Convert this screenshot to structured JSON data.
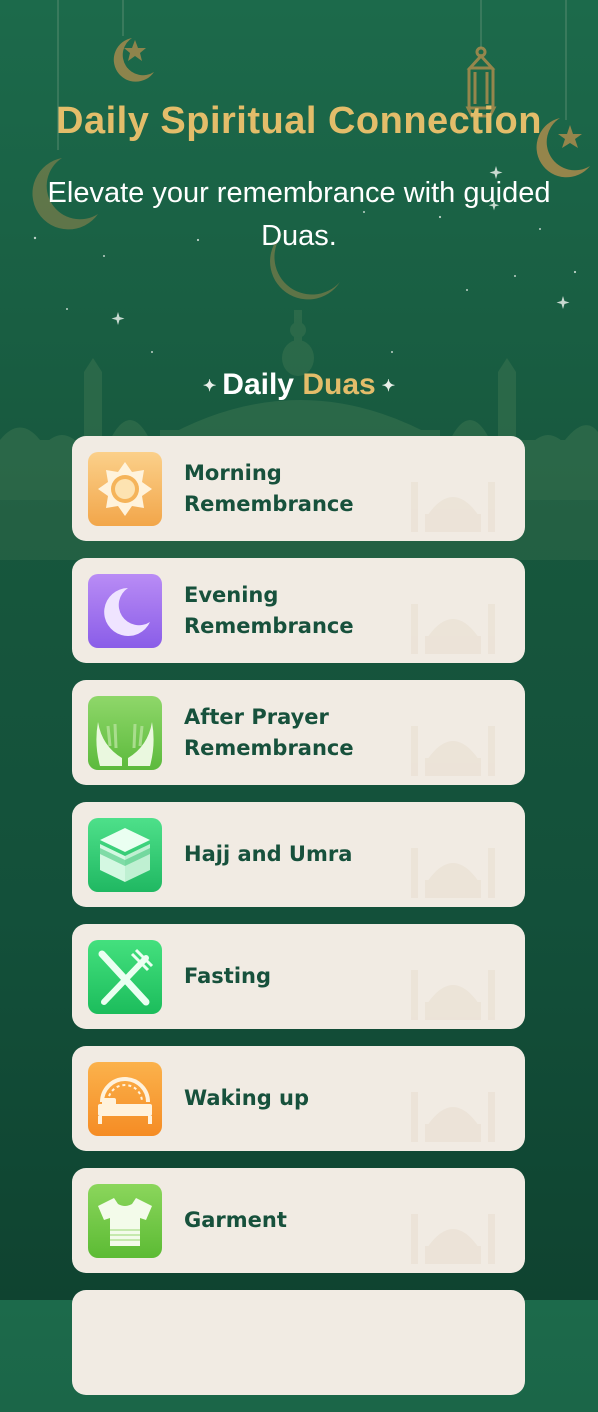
{
  "hero": {
    "title": "Daily Spiritual Connection",
    "subtitle": "Elevate your remembrance with guided Duas."
  },
  "section": {
    "title_part1": "Daily",
    "title_part2": "Duas"
  },
  "colors": {
    "background": "#17573d",
    "gold": "#e3bd6a",
    "card": "#f1ebe3",
    "label": "#17513c"
  },
  "duas": [
    {
      "label": "Morning\nRemembrance",
      "icon": "sun-icon"
    },
    {
      "label": "Evening\nRemembrance",
      "icon": "moon-icon"
    },
    {
      "label": "After Prayer\nRemembrance",
      "icon": "praying-hands-icon"
    },
    {
      "label": "Hajj and Umra",
      "icon": "kaaba-icon"
    },
    {
      "label": "Fasting",
      "icon": "fork-knife-icon"
    },
    {
      "label": "Waking up",
      "icon": "bed-icon"
    },
    {
      "label": "Garment",
      "icon": "shirt-icon"
    }
  ]
}
